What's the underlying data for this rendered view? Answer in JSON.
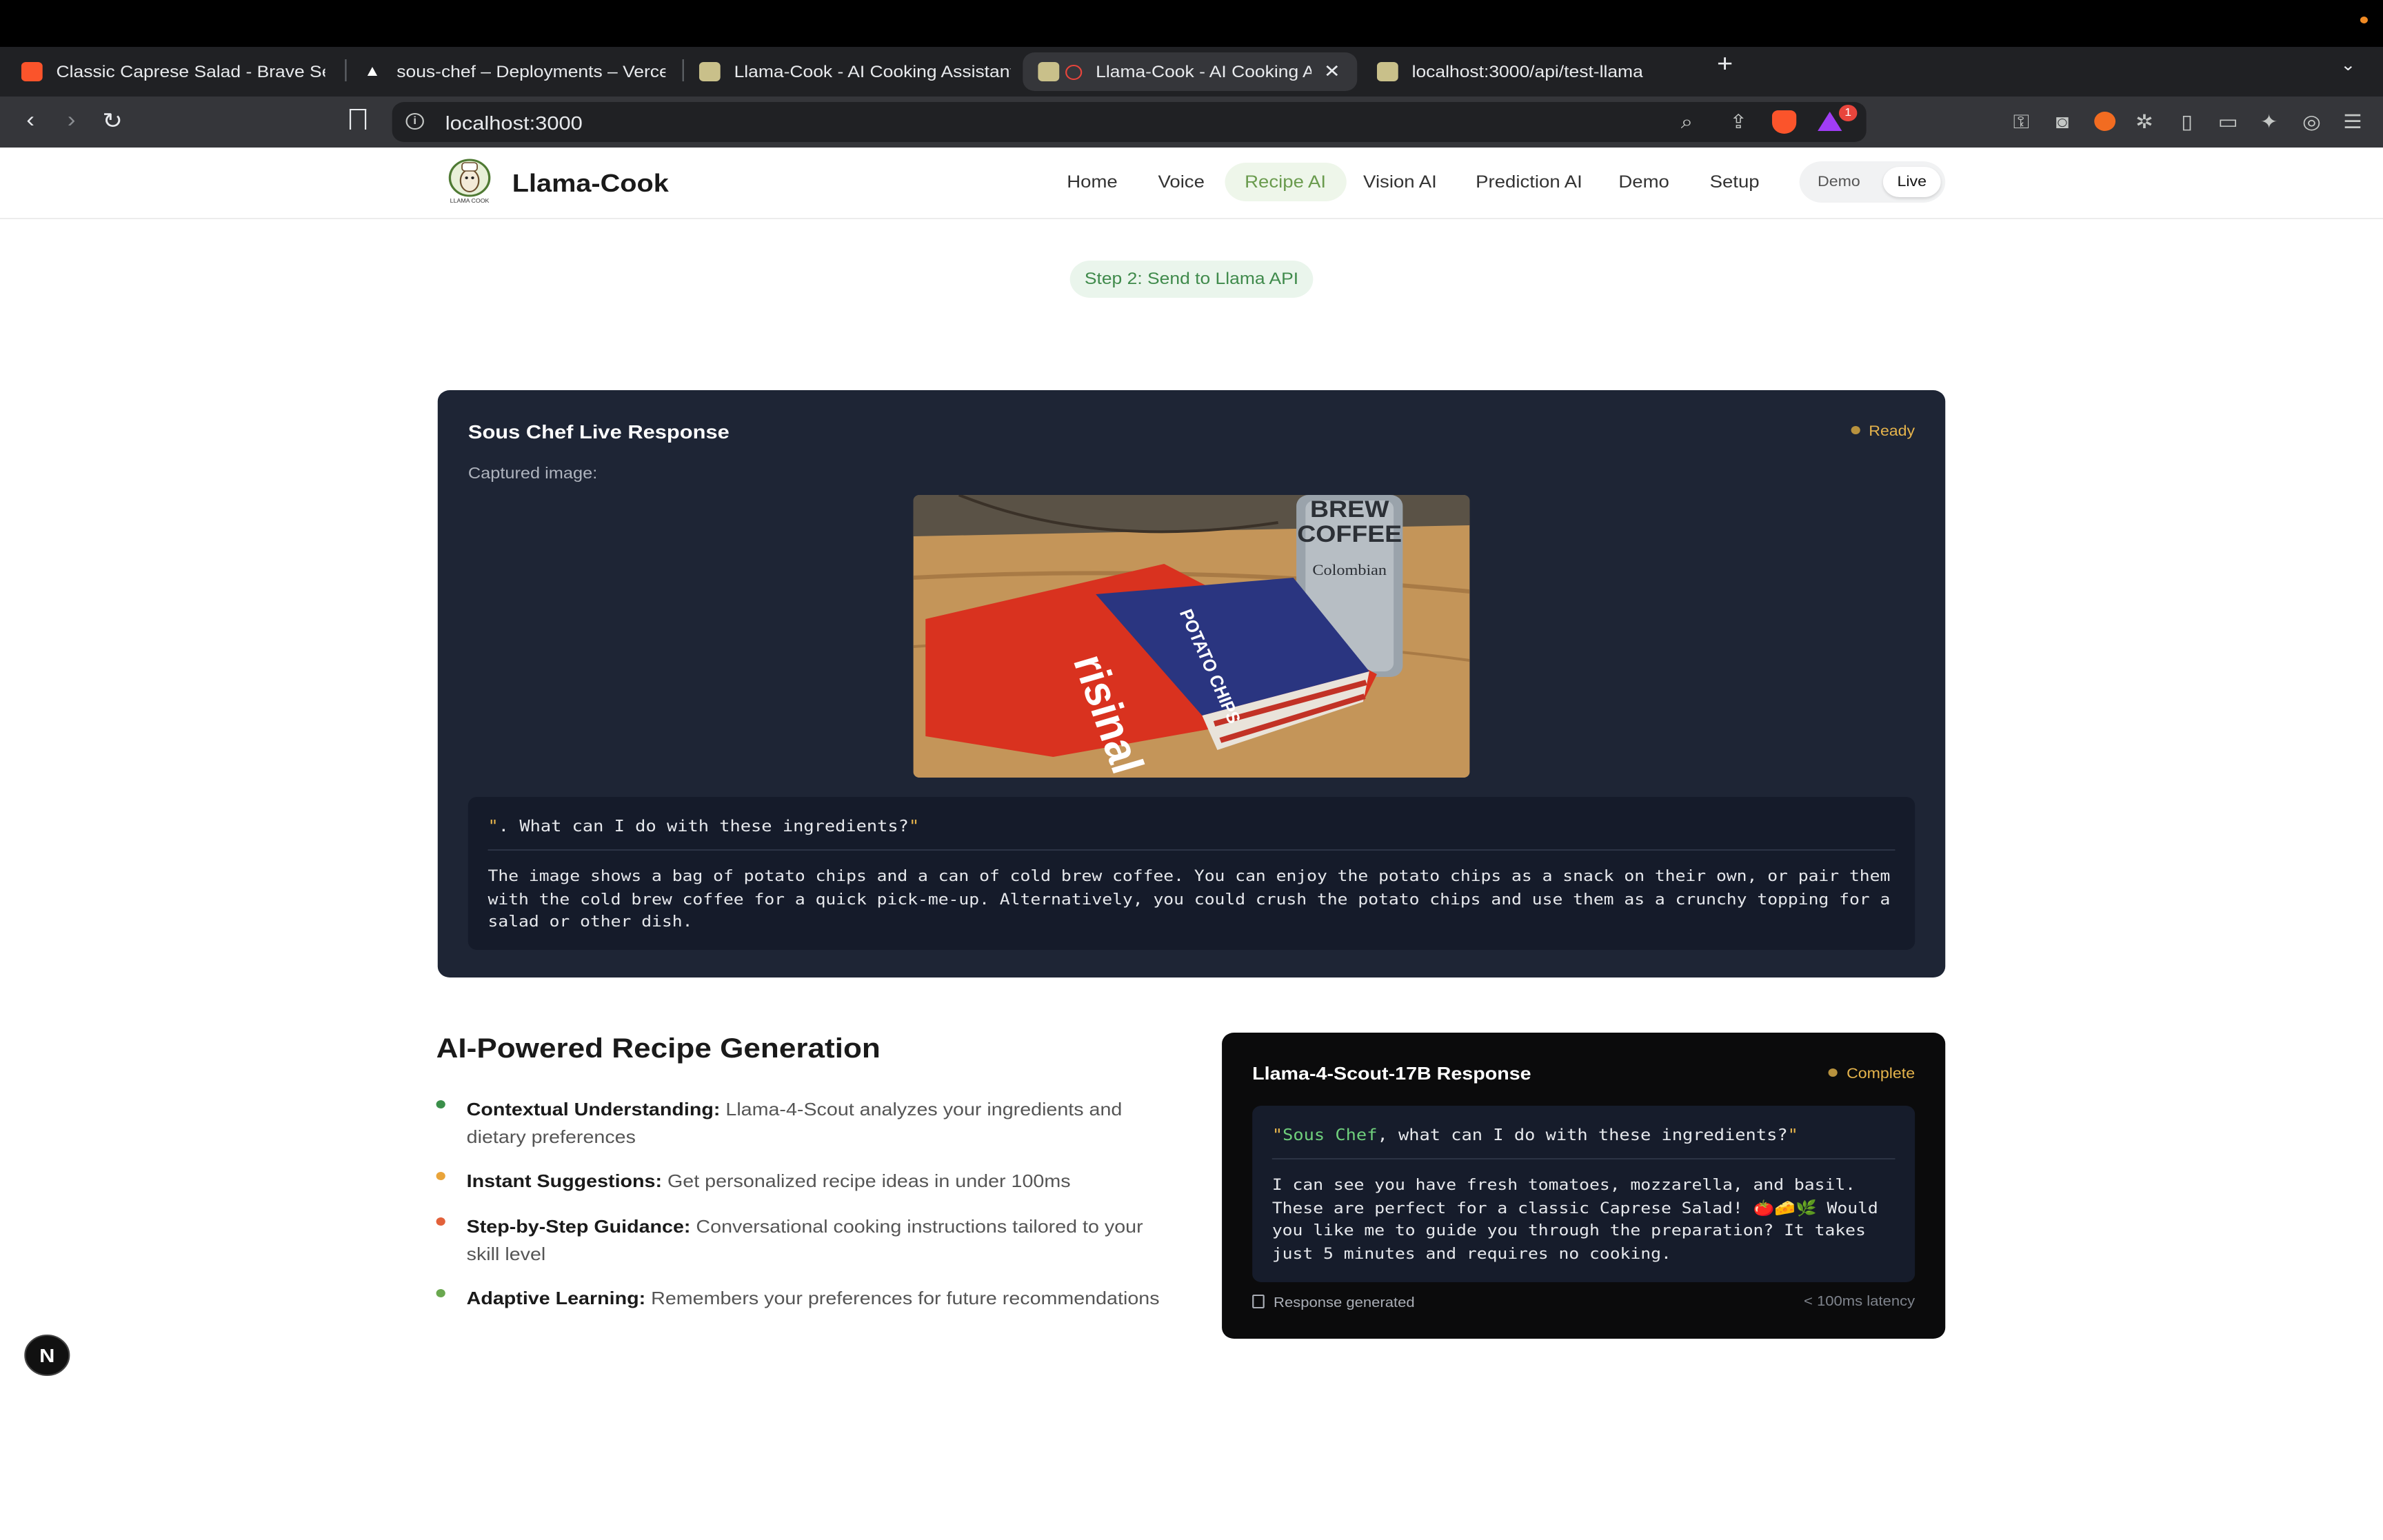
{
  "browser": {
    "tabs": [
      {
        "title": "Classic Caprese Salad - Brave Sea",
        "favicon": "brave-search-icon"
      },
      {
        "title": "sous-chef – Deployments – Vercel",
        "favicon": "vercel-icon"
      },
      {
        "title": "Llama-Cook - AI Cooking Assistant",
        "favicon": "llama-icon"
      },
      {
        "title": "Llama-Cook - AI Cooking A",
        "favicon": "llama-icon",
        "active": true
      },
      {
        "title": "localhost:3000/api/test-llama",
        "favicon": "llama-icon"
      }
    ],
    "url": "localhost:3000",
    "notification_count": "1"
  },
  "app": {
    "brand": "Llama-Cook",
    "logo_text": "LLAMA COOK",
    "nav": [
      "Home",
      "Voice",
      "Recipe AI",
      "Vision AI",
      "Prediction AI",
      "Demo",
      "Setup"
    ],
    "nav_active": "Recipe AI",
    "mode": {
      "demo": "Demo",
      "live": "Live",
      "selected": "Live"
    }
  },
  "step_pill": "Step 2: Send to Llama API",
  "live_card": {
    "title": "Sous Chef Live Response",
    "status": "Ready",
    "captured_label": "Captured image:",
    "photo_text": {
      "brand": "risinal",
      "product": "POTATO CHIPS",
      "can_top": "BREW",
      "can_mid": "COFFEE",
      "can_sub": "Colombian"
    },
    "question_prefix": "\"",
    "question_body": ". What can I do with these ingredients?",
    "question_suffix": "\"",
    "answer": "The image shows a bag of potato chips and a can of cold brew coffee. You can enjoy the potato chips as a snack on their own, or pair them with the cold brew coffee for a quick pick-me-up. Alternatively, you could crush the potato chips and use them as a crunchy topping for a salad or other dish."
  },
  "features": {
    "title": "AI-Powered Recipe Generation",
    "items": [
      {
        "label": "Contextual Understanding:",
        "text": "Llama-4-Scout analyzes your ingredients and dietary preferences",
        "color": "#3a8f4a"
      },
      {
        "label": "Instant Suggestions:",
        "text": "Get personalized recipe ideas in under 100ms",
        "color": "#e9a43a"
      },
      {
        "label": "Step-by-Step Guidance:",
        "text": "Conversational cooking instructions tailored to your skill level",
        "color": "#e2613a"
      },
      {
        "label": "Adaptive Learning:",
        "text": "Remembers your preferences for future recommendations",
        "color": "#6aa84f"
      }
    ]
  },
  "scout_card": {
    "title": "Llama-4-Scout-17B Response",
    "status": "Complete",
    "question_open": "\"",
    "question_highlight": "Sous Chef",
    "question_rest": ", what can I do with these ingredients?",
    "question_close": "\"",
    "answer": "I can see you have fresh tomatoes, mozzarella, and basil. These are perfect for a classic Caprese Salad! 🍅🧀🌿 Would you like me to guide you through the preparation? It takes just 5 minutes and requires no cooking.",
    "footer": "Response generated",
    "latency": "< 100ms latency"
  },
  "dev_badge": "N"
}
